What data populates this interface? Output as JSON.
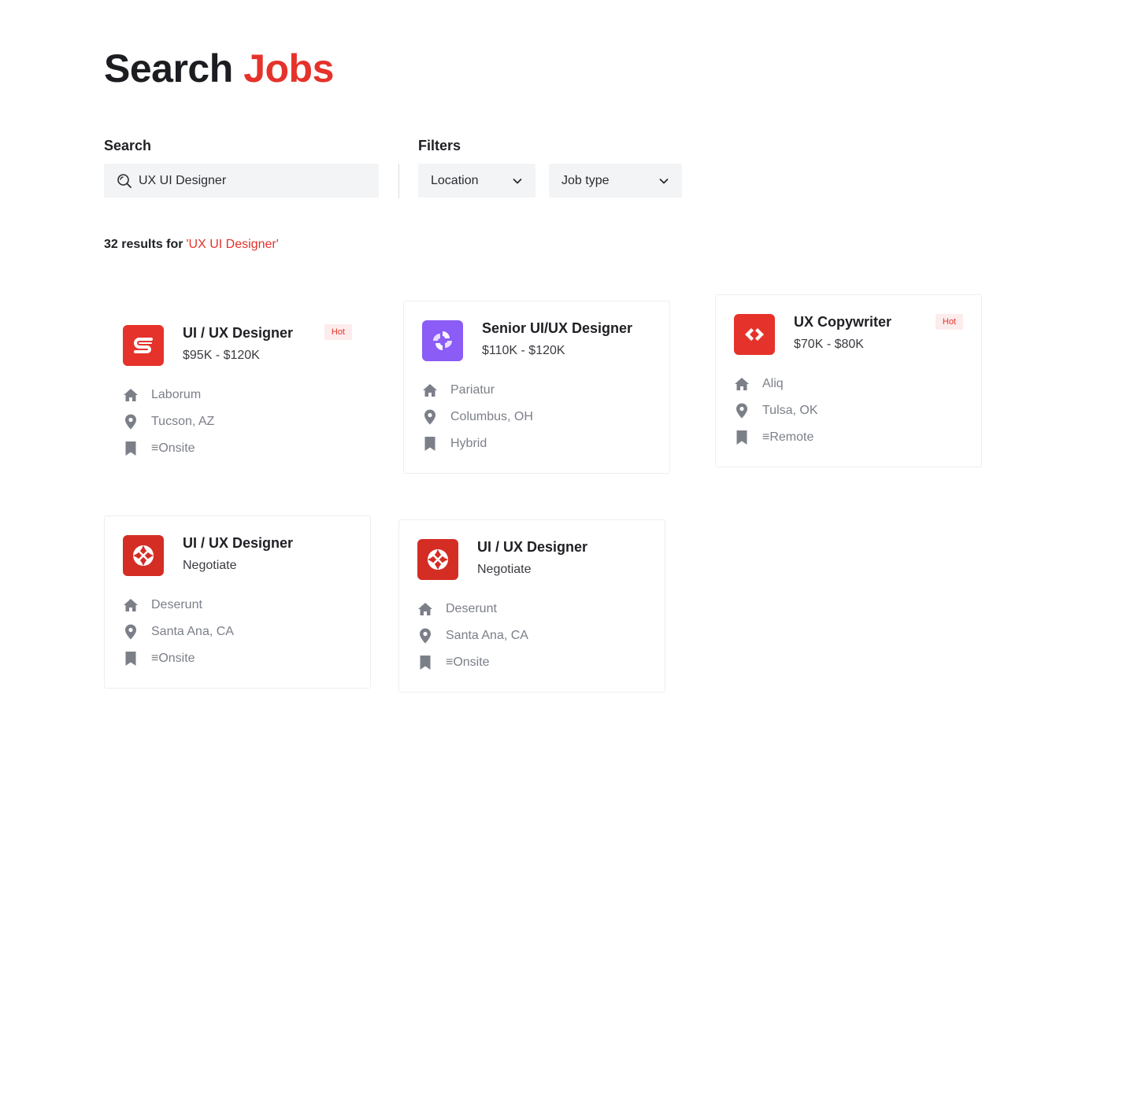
{
  "header": {
    "title_part1": "Search",
    "title_part2": "Jobs"
  },
  "search": {
    "label": "Search",
    "value": "UX UI Designer"
  },
  "filters": {
    "label": "Filters",
    "location": "Location",
    "job_type": "Job type"
  },
  "results": {
    "count_text": "32 results for",
    "query_text": "'UX UI Designer'"
  },
  "colors": {
    "accent": "#e5322b",
    "icon_gray": "#7b7f88",
    "purple": "#8b5cf6"
  },
  "jobs": [
    {
      "title": "UI / UX Designer",
      "salary": "$95K - $120K",
      "badge": "Hot",
      "company": "Laborum",
      "location": "Tucson, AZ",
      "type": "≡Onsite",
      "logo": "s-logo-icon"
    },
    {
      "title": "Senior UI/UX Designer",
      "salary": "$110K - $120K",
      "badge": "",
      "company": "Pariatur",
      "location": "Columbus, OH",
      "type": "Hybrid",
      "logo": "purple-swirl-icon"
    },
    {
      "title": "UX Copywriter",
      "salary": "$70K - $80K",
      "badge": "Hot",
      "company": "Aliq",
      "location": "Tulsa, OK",
      "type": "≡Remote",
      "logo": "diamond-arrows-icon"
    },
    {
      "title": "UI / UX Designer",
      "salary": "Negotiate",
      "badge": "",
      "company": "Deserunt",
      "location": "Santa Ana, CA",
      "type": "≡Onsite",
      "logo": "cross-logo-icon"
    },
    {
      "title": "UI / UX Designer",
      "salary": "Negotiate",
      "badge": "",
      "company": "Deserunt",
      "location": "Santa Ana, CA",
      "type": "≡Onsite",
      "logo": "cross-logo-icon"
    }
  ]
}
